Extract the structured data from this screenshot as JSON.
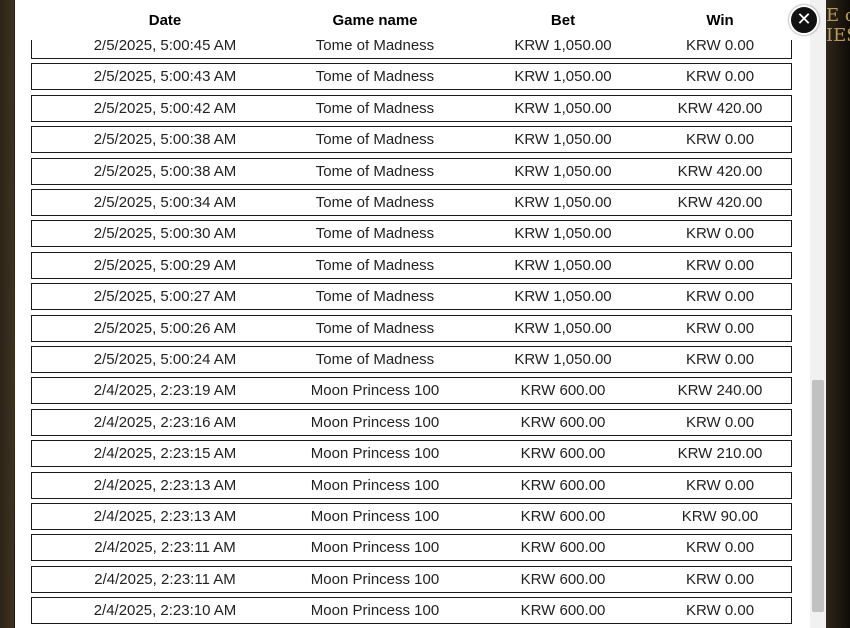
{
  "header": {
    "date": "Date",
    "game_name": "Game name",
    "bet": "Bet",
    "win": "Win"
  },
  "close_icon": "✕",
  "background_text": "E o\nIES",
  "rows": [
    {
      "date": "2/5/2025, 5:00:45 AM",
      "game": "Tome of Madness",
      "bet": "KRW 1,050.00",
      "win": "KRW 0.00"
    },
    {
      "date": "2/5/2025, 5:00:43 AM",
      "game": "Tome of Madness",
      "bet": "KRW 1,050.00",
      "win": "KRW 0.00"
    },
    {
      "date": "2/5/2025, 5:00:42 AM",
      "game": "Tome of Madness",
      "bet": "KRW 1,050.00",
      "win": "KRW 420.00"
    },
    {
      "date": "2/5/2025, 5:00:38 AM",
      "game": "Tome of Madness",
      "bet": "KRW 1,050.00",
      "win": "KRW 0.00"
    },
    {
      "date": "2/5/2025, 5:00:38 AM",
      "game": "Tome of Madness",
      "bet": "KRW 1,050.00",
      "win": "KRW 420.00"
    },
    {
      "date": "2/5/2025, 5:00:34 AM",
      "game": "Tome of Madness",
      "bet": "KRW 1,050.00",
      "win": "KRW 420.00"
    },
    {
      "date": "2/5/2025, 5:00:30 AM",
      "game": "Tome of Madness",
      "bet": "KRW 1,050.00",
      "win": "KRW 0.00"
    },
    {
      "date": "2/5/2025, 5:00:29 AM",
      "game": "Tome of Madness",
      "bet": "KRW 1,050.00",
      "win": "KRW 0.00"
    },
    {
      "date": "2/5/2025, 5:00:27 AM",
      "game": "Tome of Madness",
      "bet": "KRW 1,050.00",
      "win": "KRW 0.00"
    },
    {
      "date": "2/5/2025, 5:00:26 AM",
      "game": "Tome of Madness",
      "bet": "KRW 1,050.00",
      "win": "KRW 0.00"
    },
    {
      "date": "2/5/2025, 5:00:24 AM",
      "game": "Tome of Madness",
      "bet": "KRW 1,050.00",
      "win": "KRW 0.00"
    },
    {
      "date": "2/4/2025, 2:23:19 AM",
      "game": "Moon Princess 100",
      "bet": "KRW 600.00",
      "win": "KRW 240.00"
    },
    {
      "date": "2/4/2025, 2:23:16 AM",
      "game": "Moon Princess 100",
      "bet": "KRW 600.00",
      "win": "KRW 0.00"
    },
    {
      "date": "2/4/2025, 2:23:15 AM",
      "game": "Moon Princess 100",
      "bet": "KRW 600.00",
      "win": "KRW 210.00"
    },
    {
      "date": "2/4/2025, 2:23:13 AM",
      "game": "Moon Princess 100",
      "bet": "KRW 600.00",
      "win": "KRW 0.00"
    },
    {
      "date": "2/4/2025, 2:23:13 AM",
      "game": "Moon Princess 100",
      "bet": "KRW 600.00",
      "win": "KRW 90.00"
    },
    {
      "date": "2/4/2025, 2:23:11 AM",
      "game": "Moon Princess 100",
      "bet": "KRW 600.00",
      "win": "KRW 0.00"
    },
    {
      "date": "2/4/2025, 2:23:11 AM",
      "game": "Moon Princess 100",
      "bet": "KRW 600.00",
      "win": "KRW 0.00"
    },
    {
      "date": "2/4/2025, 2:23:10 AM",
      "game": "Moon Princess 100",
      "bet": "KRW 600.00",
      "win": "KRW 0.00"
    }
  ]
}
